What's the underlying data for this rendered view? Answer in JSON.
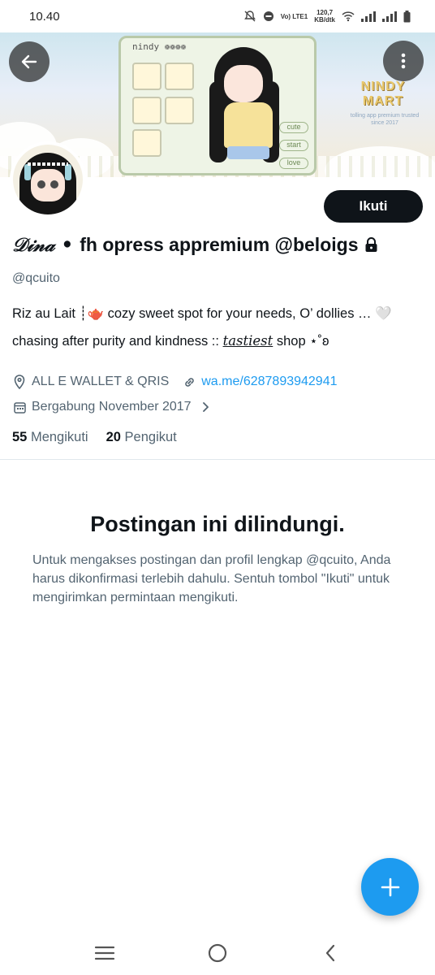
{
  "status_bar": {
    "time": "10.40",
    "network_label_top": "Vo) LTE1",
    "speed_value": "120,7",
    "speed_unit": "KB/dtk"
  },
  "banner": {
    "panel_title": "nindy ❁❁❁❁",
    "buttons": [
      "cute",
      "start",
      "love"
    ],
    "logo_line1": "NINDY",
    "logo_line2": "MART",
    "logo_sub": "tolling app premium trusted since 2017"
  },
  "profile": {
    "display_name_prefix": "𝒟𝒾𝓃𝒶 •",
    "display_name": "fh opress appremium @beloigs",
    "handle": "@qcuito",
    "bio_line1": "Riz au Lait ┊🫖  cozy sweet spot for your needs, O’ dollies … 🤍",
    "bio_line2_start": "chasing after purity and kindness :: ",
    "bio_line2_em": "tastiest",
    "bio_line2_end": " shop        ⋆˚ʚ",
    "location": "ALL E WALLET & QRIS",
    "website": "wa.me/6287893942941",
    "joined": "Bergabung November 2017",
    "following_count": "55",
    "following_label": "Mengikuti",
    "followers_count": "20",
    "followers_label": "Pengikut"
  },
  "actions": {
    "follow_label": "Ikuti"
  },
  "protected": {
    "title": "Postingan ini dilindungi.",
    "message": "Untuk mengakses postingan dan profil lengkap @qcuito, Anda harus dikonfirmasi terlebih dahulu. Sentuh tombol \"Ikuti\" untuk mengirimkan permintaan mengikuti."
  },
  "icons": {
    "back": "arrow-left-icon",
    "more": "more-vertical-icon",
    "lock": "lock-icon",
    "location": "location-pin-icon",
    "link": "link-icon",
    "calendar": "calendar-icon",
    "compose": "plus-icon"
  },
  "colors": {
    "accent": "#1d9bf0",
    "text_primary": "#0f1419",
    "text_secondary": "#536471",
    "follow_button_bg": "#0f1419"
  }
}
